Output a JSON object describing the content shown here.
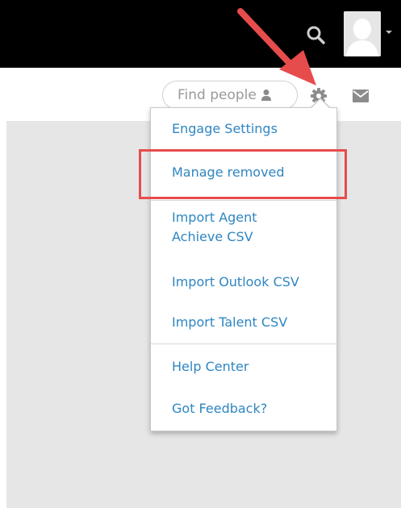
{
  "header": {
    "search_icon": "search-icon",
    "avatar_icon": "user-avatar-icon"
  },
  "toolbar": {
    "search_placeholder": "Find people",
    "person_icon": "person-icon",
    "settings_icon": "gear-icon",
    "mail_icon": "mail-icon"
  },
  "menu": {
    "items": [
      {
        "label": "Engage Settings"
      },
      {
        "label": "Manage removed"
      },
      {
        "label_line1": "Import Agent",
        "label_line2": "Achieve CSV"
      },
      {
        "label": "Import Outlook CSV"
      },
      {
        "label": "Import Talent CSV"
      },
      {
        "label": "Help Center"
      },
      {
        "label": "Got Feedback?"
      }
    ]
  },
  "colors": {
    "topbar": "#000000",
    "link": "#2e86c1",
    "annotation_red": "#e74c4c"
  }
}
